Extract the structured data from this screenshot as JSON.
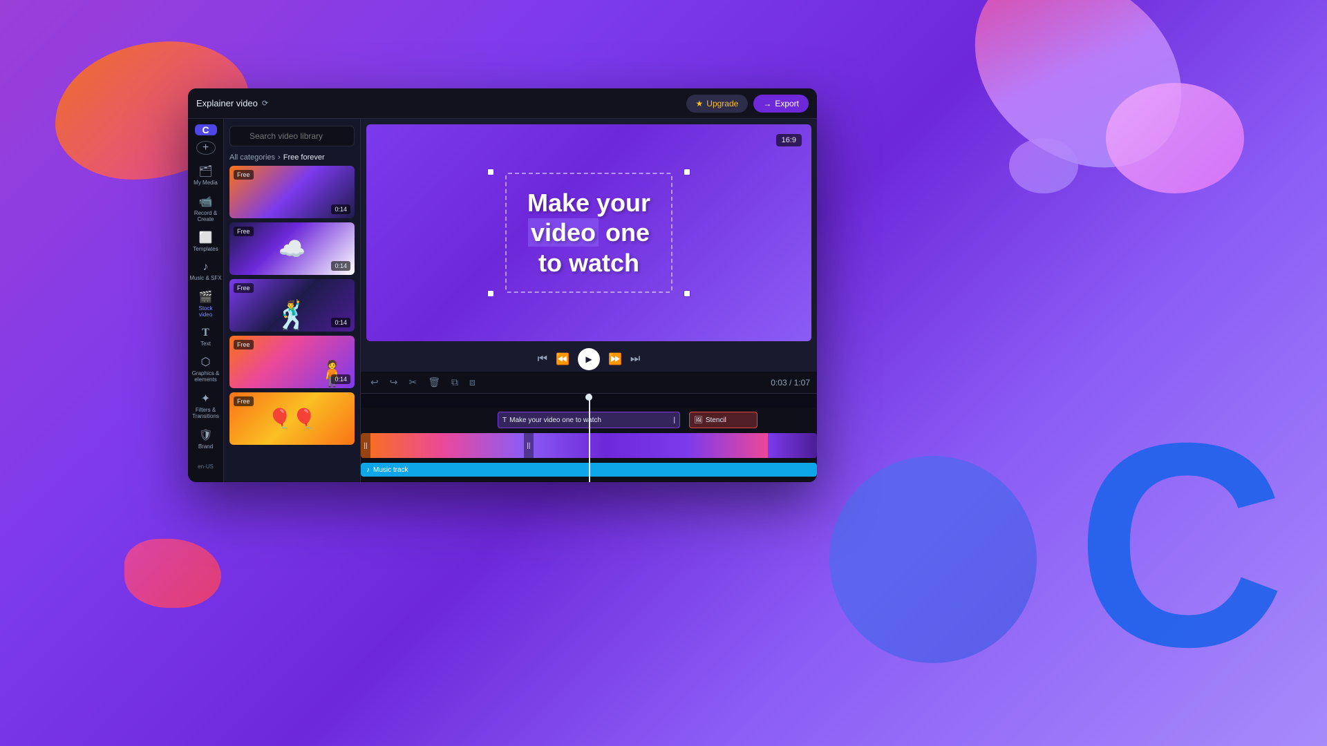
{
  "background": {
    "gradient_start": "#9b3fd8",
    "gradient_end": "#7c3aed"
  },
  "app": {
    "logo": "C",
    "project_name": "Explainer video",
    "upgrade_label": "Upgrade",
    "export_label": "Export",
    "aspect_ratio": "16:9"
  },
  "sidebar": {
    "add_button": "+",
    "items": [
      {
        "id": "my-media",
        "label": "My Media",
        "icon": "📁"
      },
      {
        "id": "record-create",
        "label": "Record &\nCreate",
        "icon": "📹"
      },
      {
        "id": "templates",
        "label": "Templates",
        "icon": "⬜"
      },
      {
        "id": "music-sfx",
        "label": "Music & SFX",
        "icon": "🎵"
      },
      {
        "id": "stock-video",
        "label": "Stock\nvideo",
        "icon": "🎬",
        "active": true
      },
      {
        "id": "text",
        "label": "Text",
        "icon": "T"
      },
      {
        "id": "graphics-elements",
        "label": "Graphics &\nelements",
        "icon": "⬡"
      },
      {
        "id": "filters-transitions",
        "label": "Filters &\nTransitions",
        "icon": "✦"
      },
      {
        "id": "brand",
        "label": "Brand",
        "icon": "🛡"
      }
    ],
    "locale": "en-US"
  },
  "media_panel": {
    "search_placeholder": "Search video library",
    "breadcrumb_all": "All categories",
    "breadcrumb_current": "Free forever",
    "videos": [
      {
        "id": 1,
        "duration": "0:14",
        "free": true,
        "thumb_class": "thumb-1"
      },
      {
        "id": 2,
        "duration": "0:14",
        "free": true,
        "thumb_class": "thumb-2"
      },
      {
        "id": 3,
        "duration": "0:14",
        "free": true,
        "thumb_class": "thumb-3"
      },
      {
        "id": 4,
        "duration": "0:14",
        "free": true,
        "thumb_class": "thumb-4"
      },
      {
        "id": 5,
        "duration": "",
        "free": true,
        "thumb_class": "thumb-5"
      }
    ],
    "free_label": "Free",
    "separator": "›"
  },
  "preview": {
    "text_line1": "Make your",
    "text_line2": "video one",
    "text_line2_highlight": "video",
    "text_line3": "to watch",
    "aspect_ratio": "16:9"
  },
  "timeline": {
    "time_current": "0:03",
    "time_total": "1:07",
    "time_display": "0:03 / 1:07",
    "text_clip_label": "Make your video one to watch",
    "stencil_label": "Stencil",
    "music_track_label": "Music track",
    "tools": [
      "undo",
      "redo",
      "scissors",
      "trash",
      "copy",
      "overlay"
    ]
  }
}
